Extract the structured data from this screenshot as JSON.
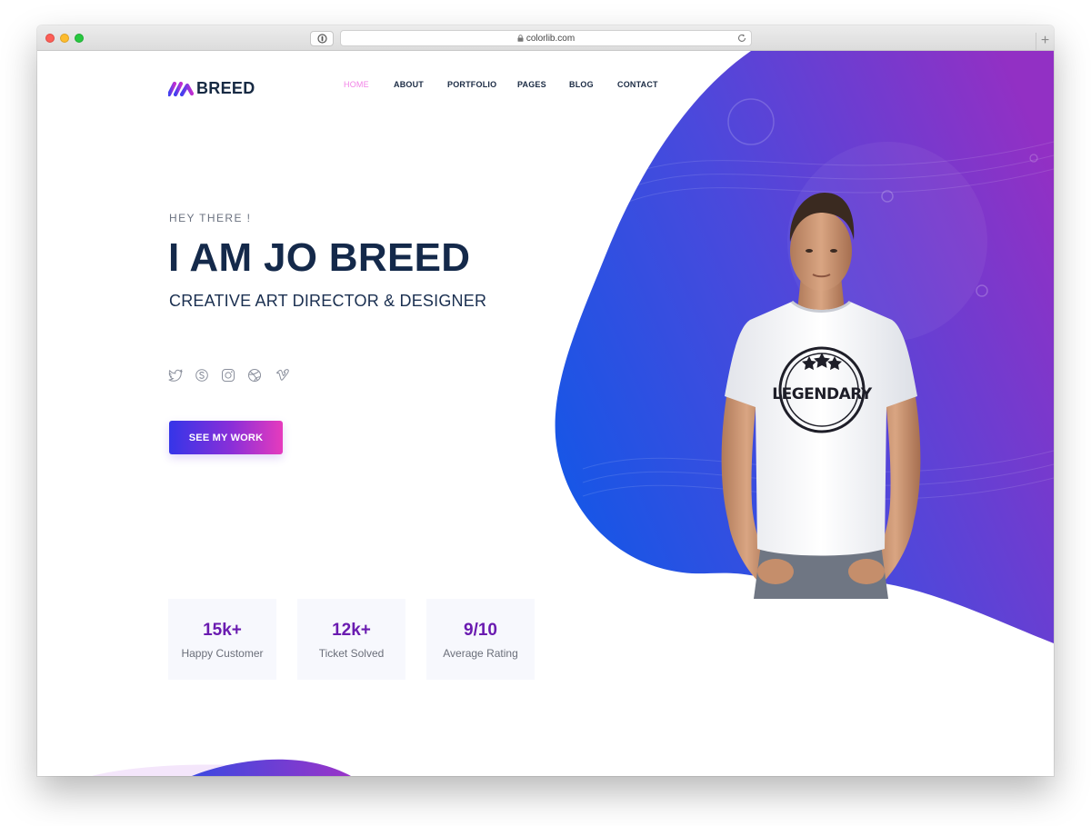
{
  "browser": {
    "url": "colorlib.com"
  },
  "site": {
    "logo_text": "BREED"
  },
  "nav": {
    "items": [
      {
        "label": "HOME",
        "active": true
      },
      {
        "label": "ABOUT",
        "active": false
      },
      {
        "label": "PORTFOLIO",
        "active": false
      },
      {
        "label": "PAGES",
        "active": false
      },
      {
        "label": "BLOG",
        "active": false
      },
      {
        "label": "CONTACT",
        "active": false
      }
    ]
  },
  "hero": {
    "greeting": "HEY THERE !",
    "title": "I AM JO BREED",
    "subtitle": "CREATIVE ART DIRECTOR & DESIGNER",
    "cta_label": "SEE MY WORK",
    "tshirt_text": "LEGENDARY",
    "socials": [
      "twitter-icon",
      "skype-icon",
      "instagram-icon",
      "dribbble-icon",
      "vimeo-icon"
    ]
  },
  "stats": [
    {
      "value": "15k+",
      "label": "Happy Customer"
    },
    {
      "value": "12k+",
      "label": "Ticket Solved"
    },
    {
      "value": "9/10",
      "label": "Average Rating"
    }
  ],
  "colors": {
    "nav_active": "#f282e6",
    "heading": "#14294a",
    "stat_value": "#6a1bb0",
    "blob_start": "#1a52e6",
    "blob_end": "#8e2ec6",
    "cta_start": "#3535e8",
    "cta_end": "#e63bbd"
  }
}
